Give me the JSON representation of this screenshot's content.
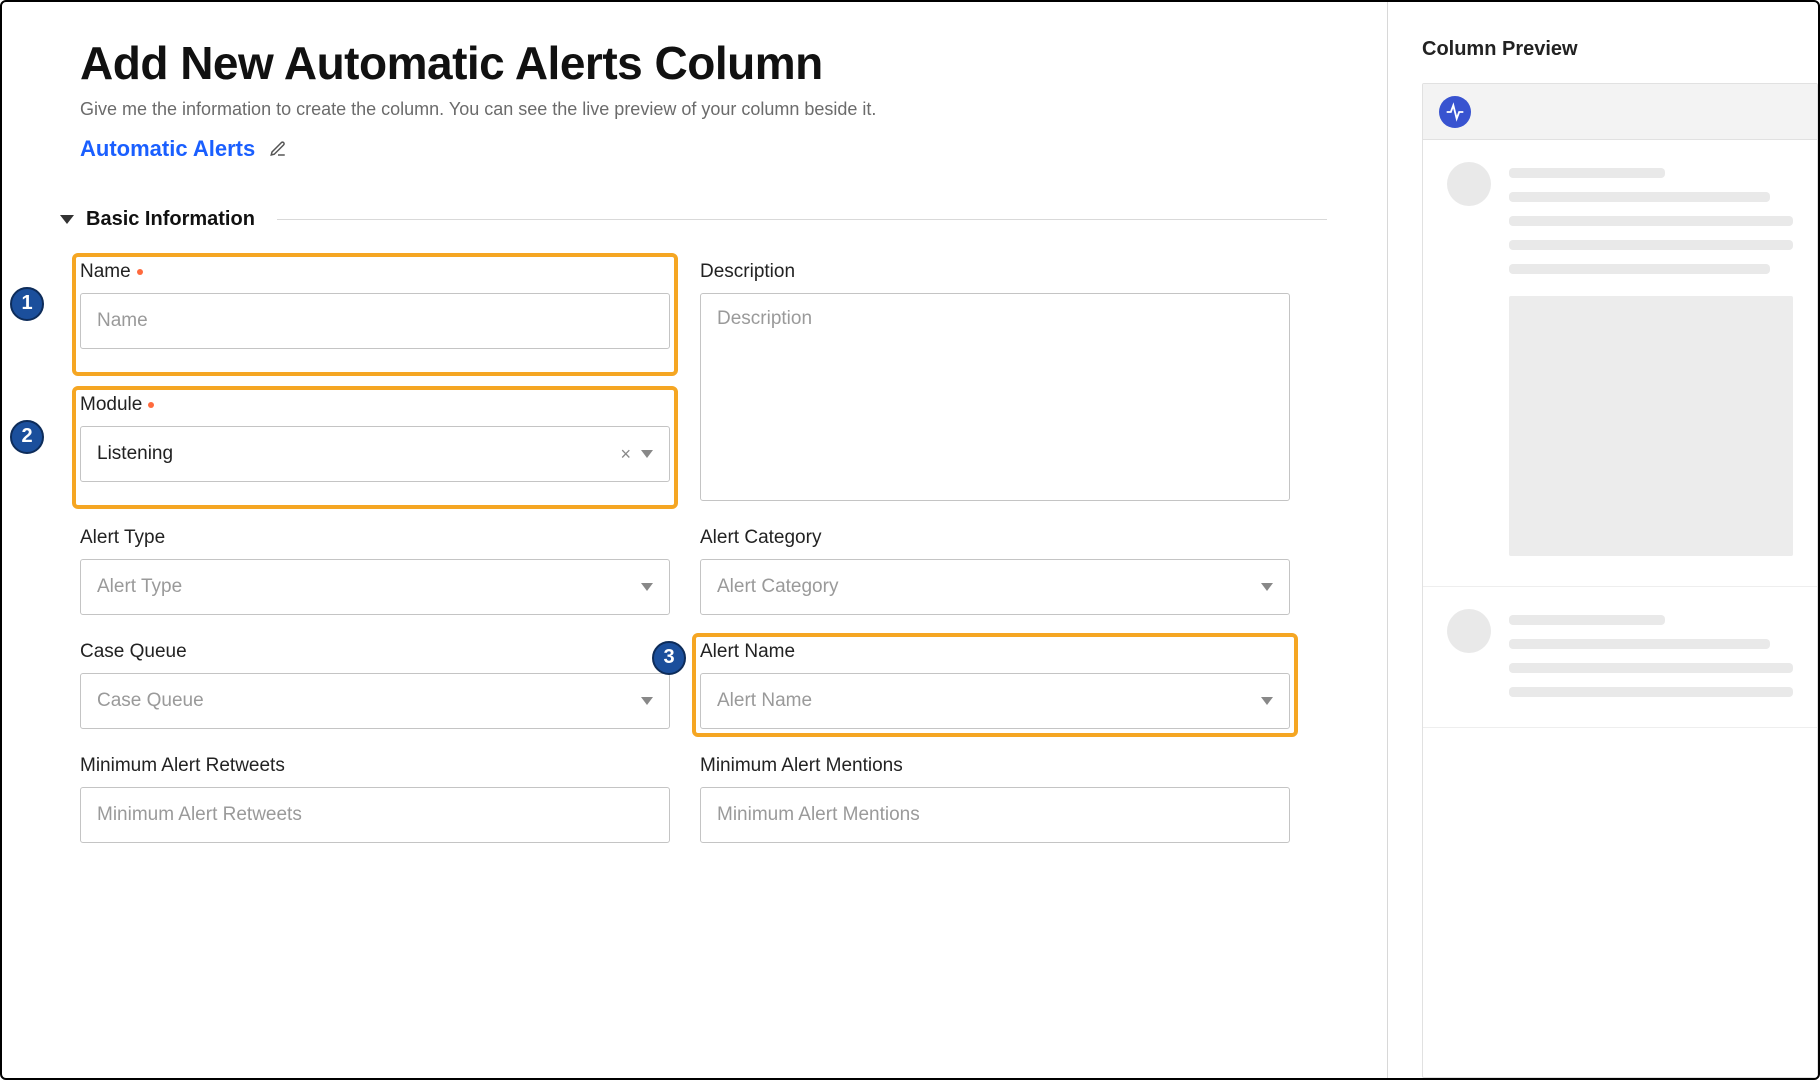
{
  "header": {
    "title": "Add New Automatic Alerts Column",
    "subtitle": "Give me the information to create the column. You can see the live preview of your column beside it.",
    "breadcrumb": "Automatic Alerts"
  },
  "section": {
    "title": "Basic Information"
  },
  "fields": {
    "name": {
      "label": "Name",
      "placeholder": "Name",
      "value": "",
      "required": true
    },
    "description": {
      "label": "Description",
      "placeholder": "Description",
      "value": ""
    },
    "module": {
      "label": "Module",
      "value": "Listening",
      "required": true
    },
    "alert_type": {
      "label": "Alert Type",
      "placeholder": "Alert Type",
      "value": ""
    },
    "alert_category": {
      "label": "Alert Category",
      "placeholder": "Alert Category",
      "value": ""
    },
    "case_queue": {
      "label": "Case Queue",
      "placeholder": "Case Queue",
      "value": ""
    },
    "alert_name": {
      "label": "Alert Name",
      "placeholder": "Alert Name",
      "value": ""
    },
    "min_retweets": {
      "label": "Minimum Alert Retweets",
      "placeholder": "Minimum Alert Retweets",
      "value": ""
    },
    "min_mentions": {
      "label": "Minimum Alert Mentions",
      "placeholder": "Minimum Alert Mentions",
      "value": ""
    }
  },
  "steps": {
    "one": "1",
    "two": "2",
    "three": "3"
  },
  "preview": {
    "title": "Column Preview"
  },
  "colors": {
    "accent": "#1a5fff",
    "highlight": "#f5a623",
    "badge": "#1b4f9c"
  }
}
